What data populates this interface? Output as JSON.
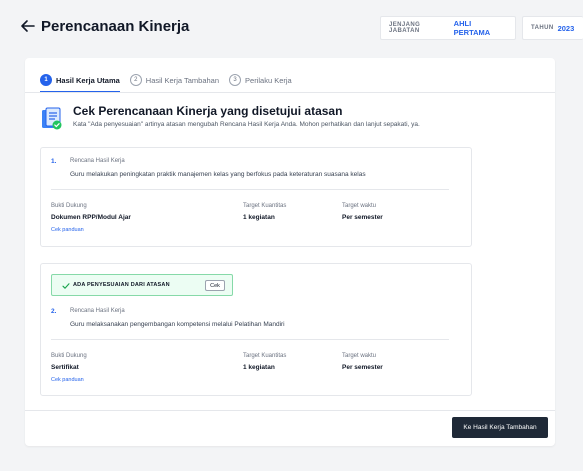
{
  "header": {
    "title": "Perencanaan Kinerja",
    "level_label": "JENJANG JABATAN",
    "level_value": "AHLI PERTAMA",
    "year_label": "TAHUN",
    "year_value": "2023"
  },
  "tabs": [
    {
      "number": "1",
      "label": "Hasil Kerja Utama"
    },
    {
      "number": "2",
      "label": "Hasil Kerja Tambahan"
    },
    {
      "number": "3",
      "label": "Perilaku Kerja"
    }
  ],
  "intro": {
    "title": "Cek Perencanaan Kinerja yang disetujui atasan",
    "description": "Kata \"Ada penyesuaian\" artinya atasan mengubah Rencana Hasil Kerja Anda. Mohon perhatikan dan lanjut sepakati, ya."
  },
  "columns": {
    "evidence": "Bukti Dukung",
    "quantity": "Target Kuantitas",
    "time": "Target waktu"
  },
  "items": [
    {
      "number": "1.",
      "caption": "Rencana Hasil Kerja",
      "text": "Guru melakukan peningkatan praktik manajemen kelas yang berfokus pada keteraturan suasana kelas",
      "evidence": "Dokumen RPP/Modul Ajar",
      "quantity": "1 kegiatan",
      "time": "Per semester",
      "guide_link": "Cek panduan"
    },
    {
      "number": "2.",
      "caption": "Rencana Hasil Kerja",
      "text": "Guru melaksanakan pengembangan kompetensi melalui Pelatihan Mandiri",
      "evidence": "Sertifikat",
      "quantity": "1 kegiatan",
      "time": "Per semester",
      "guide_link": "Cek panduan",
      "adjustment_badge": "ADA PENYESUAIAN DARI ATASAN",
      "adjustment_button": "Cek"
    }
  ],
  "footer": {
    "next_button": "Ke Hasil Kerja Tambahan"
  },
  "colors": {
    "accent": "#2563eb",
    "success_bg": "#ecfdf3",
    "success_border": "#86d9a8",
    "dark_button": "#1f2937"
  }
}
